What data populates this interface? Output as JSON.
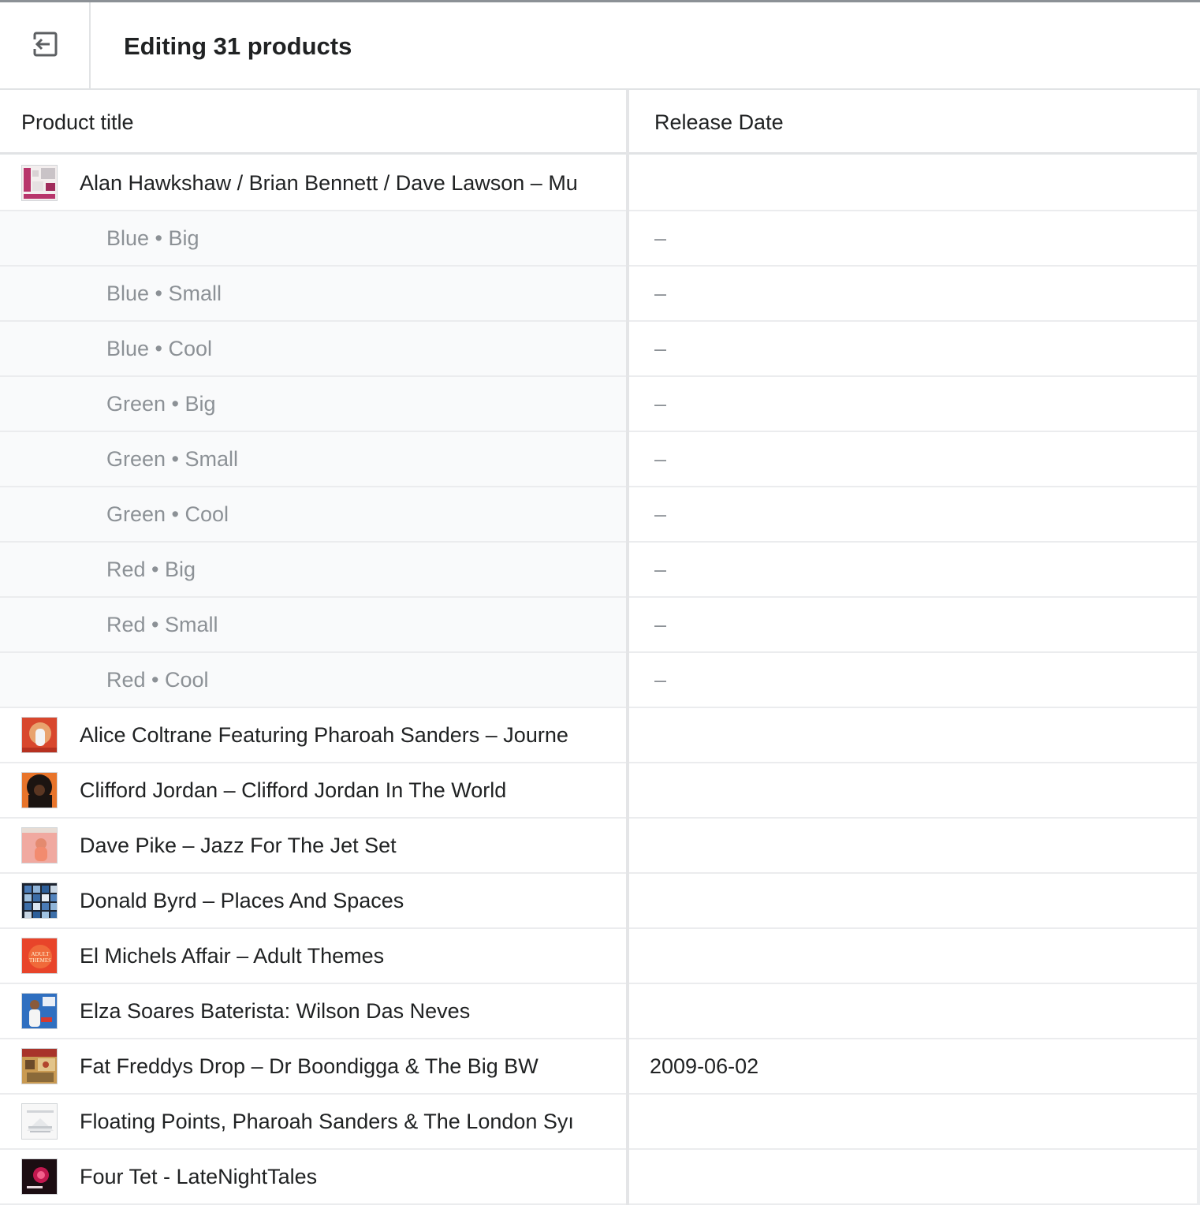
{
  "header": {
    "title": "Editing 31 products",
    "exit_icon": "exit-icon"
  },
  "table": {
    "columns": [
      "Product title",
      "Release Date"
    ],
    "rows": [
      {
        "type": "product",
        "title": "Alan Hawkshaw / Brian Bennett / Dave Lawson – Mu",
        "date": "",
        "thumb": "album-cover-alan-hawkshaw"
      },
      {
        "type": "variant",
        "title": "Blue • Big",
        "date": "–"
      },
      {
        "type": "variant",
        "title": "Blue • Small",
        "date": "–"
      },
      {
        "type": "variant",
        "title": "Blue • Cool",
        "date": "–"
      },
      {
        "type": "variant",
        "title": "Green • Big",
        "date": "–"
      },
      {
        "type": "variant",
        "title": "Green • Small",
        "date": "–"
      },
      {
        "type": "variant",
        "title": "Green • Cool",
        "date": "–"
      },
      {
        "type": "variant",
        "title": "Red • Big",
        "date": "–"
      },
      {
        "type": "variant",
        "title": "Red • Small",
        "date": "–"
      },
      {
        "type": "variant",
        "title": "Red • Cool",
        "date": "–"
      },
      {
        "type": "product",
        "title": "Alice Coltrane Featuring Pharoah Sanders – Journe",
        "date": "",
        "thumb": "album-cover-alice-coltrane"
      },
      {
        "type": "product",
        "title": "Clifford Jordan – Clifford Jordan In The World",
        "date": "",
        "thumb": "album-cover-clifford-jordan"
      },
      {
        "type": "product",
        "title": "Dave Pike – Jazz For The Jet Set",
        "date": "",
        "thumb": "album-cover-dave-pike"
      },
      {
        "type": "product",
        "title": "Donald Byrd – Places And Spaces",
        "date": "",
        "thumb": "album-cover-donald-byrd"
      },
      {
        "type": "product",
        "title": "El Michels Affair – Adult Themes",
        "date": "",
        "thumb": "album-cover-el-michels"
      },
      {
        "type": "product",
        "title": "Elza Soares Baterista: Wilson Das Neves",
        "date": "",
        "thumb": "album-cover-elza-soares"
      },
      {
        "type": "product",
        "title": "Fat Freddys Drop – Dr Boondigga & The Big BW",
        "date": "2009-06-02",
        "thumb": "album-cover-fat-freddys"
      },
      {
        "type": "product",
        "title": "Floating Points, Pharoah Sanders & The London Syı",
        "date": "",
        "thumb": "album-cover-floating-points"
      },
      {
        "type": "product",
        "title": "Four Tet - LateNightTales",
        "date": "",
        "thumb": "album-cover-four-tet"
      }
    ]
  },
  "thumb_text": {
    "adult_themes": "ADULT THEMES"
  }
}
